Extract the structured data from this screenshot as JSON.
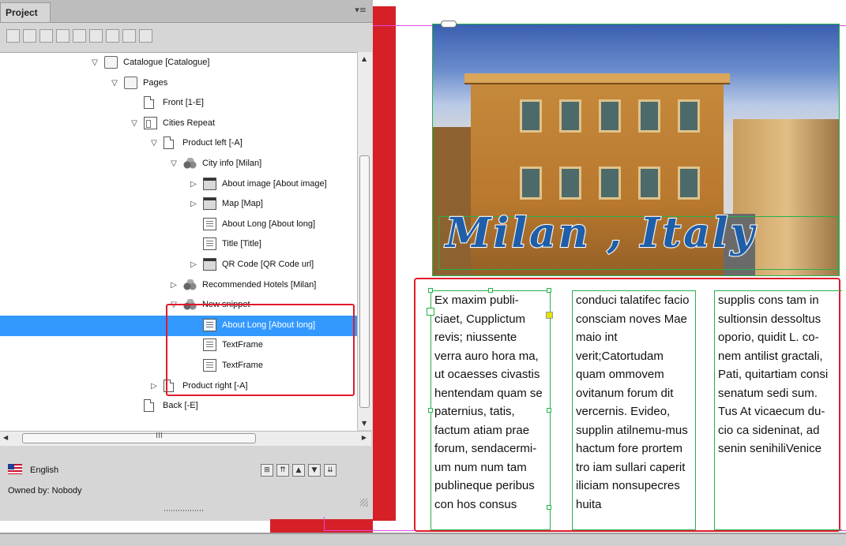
{
  "panel": {
    "tab_label": "Project",
    "menu_glyph": "▾≡",
    "toolbar_buttons": [
      "icon-1",
      "icon-2",
      "icon-3",
      "icon-4",
      "icon-5",
      "icon-6",
      "icon-7",
      "icon-8",
      "icon-9"
    ],
    "tree": [
      {
        "label": "Catalogue [Catalogue]",
        "icon": "catalogue-icon",
        "toggle": "▽"
      },
      {
        "label": "Pages",
        "icon": "pages-icon",
        "toggle": "▽"
      },
      {
        "label": "Front [1-E]",
        "icon": "page-icon",
        "toggle": ""
      },
      {
        "label": "Cities Repeat",
        "icon": "repeat-icon",
        "toggle": "▽"
      },
      {
        "label": "Product left [-A]",
        "icon": "page-icon",
        "toggle": "▽"
      },
      {
        "label": "City info [Milan]",
        "icon": "snippet-icon",
        "toggle": "▽"
      },
      {
        "label": "About image [About image]",
        "icon": "image-frame-icon",
        "toggle": "▷"
      },
      {
        "label": "Map [Map]",
        "icon": "image-frame-icon",
        "toggle": "▷"
      },
      {
        "label": "About Long [About long]",
        "icon": "text-frame-icon",
        "toggle": ""
      },
      {
        "label": "Title [Title]",
        "icon": "text-frame-icon",
        "toggle": ""
      },
      {
        "label": "QR Code [QR Code url]",
        "icon": "image-frame-icon",
        "toggle": "▷"
      },
      {
        "label": "Recommended Hotels [Milan]",
        "icon": "snippet-icon",
        "toggle": "▷"
      },
      {
        "label": "New snippet",
        "icon": "snippet-icon",
        "toggle": "▽"
      },
      {
        "label": "About Long [About long]",
        "icon": "text-frame-icon",
        "toggle": ""
      },
      {
        "label": "TextFrame",
        "icon": "text-frame-icon",
        "toggle": ""
      },
      {
        "label": "TextFrame",
        "icon": "text-frame-icon",
        "toggle": ""
      },
      {
        "label": "Product right [-A]",
        "icon": "page-icon",
        "toggle": "▷"
      },
      {
        "label": "Back [-E]",
        "icon": "page-icon",
        "toggle": ""
      }
    ],
    "selected_index": 13,
    "hscroll_grip": "III",
    "footer": {
      "language": "English",
      "owner": "Owned by: Nobody",
      "nav_buttons": [
        "⊞",
        "⇈",
        "▲",
        "▼",
        "⇊"
      ]
    }
  },
  "document": {
    "title": "Milan , Italy",
    "columns": [
      "Ex maxim publi-ciaet, Cupplictum revis; niussente verra auro hora ma, ut ocaesses civastis hentendam quam se paternius, tatis, factum atiam prae forum, sendacermi-um num num tam publineque peribus con hos consus",
      "conduci talatifec facio consciam noves Mae maio int verit;Catortudam quam ommovem ovitanum forum dit vercernis. Evideo, supplin atilnemu-mus hactum fore prortem tro iam sullari caperit iliciam nonsupecres huita",
      "supplis cons tam in sultionsin dessoltus oporio, quidit L. co-nem antilist gractali, Pati, quitartiam consi senatum sedi sum. Tus At vicaecum du-cio ca sideninat, ad senin senihiliVenice"
    ],
    "colors": {
      "accent_red": "#e01a2a",
      "frame_green": "#24b24b",
      "selection_blue": "#3399ff",
      "title_blue": "#1f5ea8"
    }
  }
}
